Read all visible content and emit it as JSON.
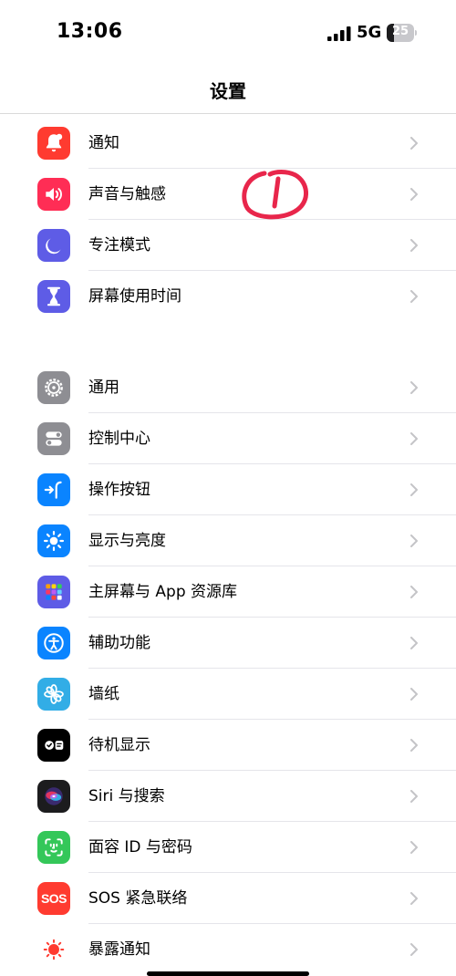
{
  "status": {
    "time": "13:06",
    "network": "5G",
    "battery": "25",
    "battery_level": 0.25
  },
  "nav": {
    "title": "设置"
  },
  "groups": [
    {
      "items": [
        {
          "label": "通知",
          "icon": "bell-icon",
          "color": "#ff3b30"
        },
        {
          "label": "声音与触感",
          "icon": "speaker-icon",
          "color": "#ff2d55"
        },
        {
          "label": "专注模式",
          "icon": "moon-icon",
          "color": "#5e5ce6"
        },
        {
          "label": "屏幕使用时间",
          "icon": "hourglass-icon",
          "color": "#5e5ce6"
        }
      ]
    },
    {
      "items": [
        {
          "label": "通用",
          "icon": "gear-icon",
          "color": "#8e8e93"
        },
        {
          "label": "控制中心",
          "icon": "toggles-icon",
          "color": "#8e8e93"
        },
        {
          "label": "操作按钮",
          "icon": "action-button-icon",
          "color": "#0a84ff"
        },
        {
          "label": "显示与亮度",
          "icon": "sun-icon",
          "color": "#0a84ff"
        },
        {
          "label": "主屏幕与 App 资源库",
          "icon": "app-grid-icon",
          "color": "#5e5ce6"
        },
        {
          "label": "辅助功能",
          "icon": "accessibility-icon",
          "color": "#0a84ff"
        },
        {
          "label": "墙纸",
          "icon": "flower-icon",
          "color": "#32ade6"
        },
        {
          "label": "待机显示",
          "icon": "standby-icon",
          "color": "#000000"
        },
        {
          "label": "Siri 与搜索",
          "icon": "siri-icon",
          "color": "#1c1c1e"
        },
        {
          "label": "面容 ID 与密码",
          "icon": "faceid-icon",
          "color": "#34c759"
        },
        {
          "label": "SOS 紧急联络",
          "icon": "sos-icon",
          "color": "#ff3b30"
        },
        {
          "label": "暴露通知",
          "icon": "exposure-icon",
          "color": "#ffffff"
        }
      ]
    }
  ],
  "sos_icon_text": "SOS"
}
